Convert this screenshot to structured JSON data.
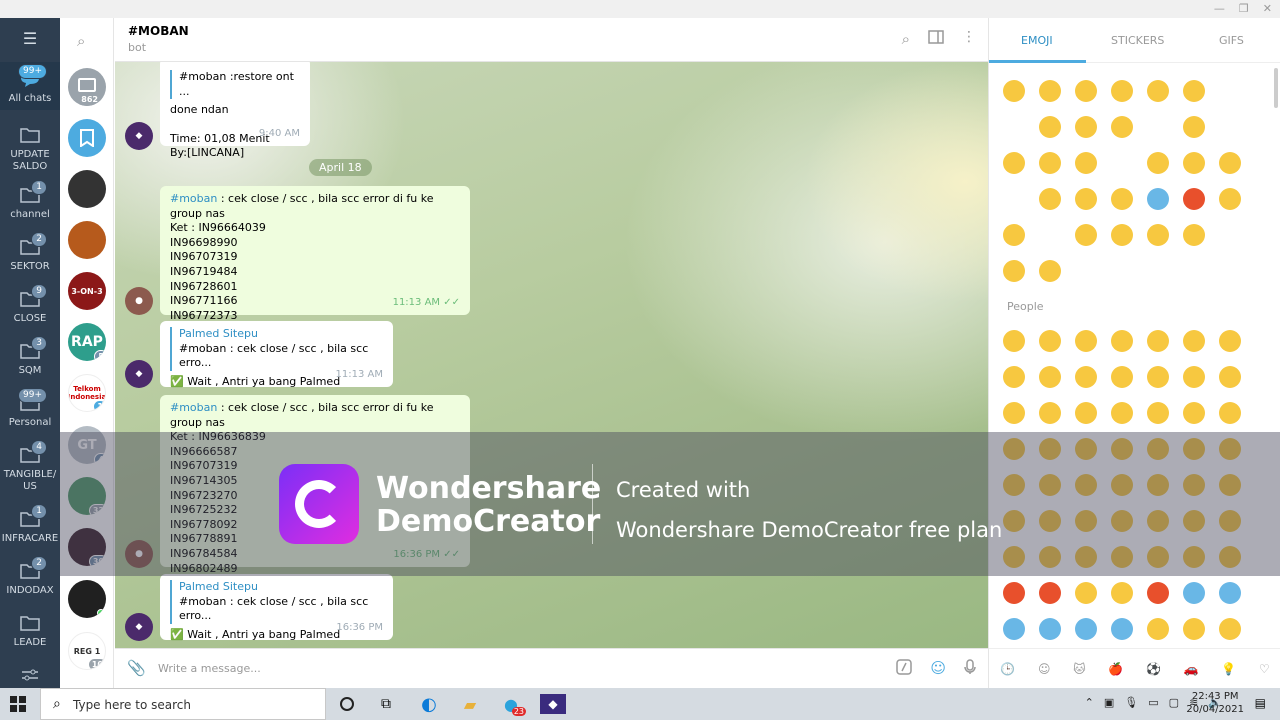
{
  "window": {
    "minimize": "—",
    "restore": "❐",
    "close": "✕"
  },
  "folders": [
    {
      "label": "All chats",
      "badge": "99+",
      "icon": "chat-bubble-icon"
    },
    {
      "label": "UPDATE SALDO",
      "badge": "",
      "icon": "folder-icon"
    },
    {
      "label": "channel",
      "badge": "1",
      "icon": "folder-icon"
    },
    {
      "label": "SEKTOR",
      "badge": "2",
      "icon": "folder-icon"
    },
    {
      "label": "CLOSE",
      "badge": "9",
      "icon": "folder-icon"
    },
    {
      "label": "SQM",
      "badge": "3",
      "icon": "folder-icon"
    },
    {
      "label": "Personal",
      "badge": "99+",
      "icon": "folder-icon"
    },
    {
      "label": "TANGIBLE/ US",
      "badge": "4",
      "icon": "folder-icon"
    },
    {
      "label": "INFRACARE",
      "badge": "1",
      "icon": "folder-icon"
    },
    {
      "label": "INDODAX",
      "badge": "2",
      "icon": "folder-icon"
    },
    {
      "label": "LEADE",
      "badge": "",
      "icon": "folder-icon"
    }
  ],
  "chats": [
    {
      "text": "",
      "badge": "862",
      "color": "#9aa3ab"
    },
    {
      "text": "",
      "badge": "",
      "color": "#4dabe0"
    },
    {
      "text": "",
      "badge": "",
      "color": "#333333"
    },
    {
      "text": "",
      "badge": "",
      "color": "#b65a1c"
    },
    {
      "text": "3-ON-3",
      "badge": "",
      "color": "#8c1818"
    },
    {
      "text": "RAP",
      "badge": "5",
      "color": "#2e9e8c"
    },
    {
      "text": "Telkom Indonesia",
      "badge": "1",
      "color": "#ffffff"
    },
    {
      "text": "GT",
      "badge": "4",
      "color": "#b4bcc4"
    },
    {
      "text": "",
      "badge": "33",
      "color": "#4f9a68"
    },
    {
      "text": "",
      "badge": "30",
      "color": "#3a1f2a"
    },
    {
      "text": "",
      "badge": "",
      "color": "#202020"
    },
    {
      "text": "REG 1",
      "badge": "10",
      "color": "#ffffff"
    }
  ],
  "header": {
    "title": "#MOBAN",
    "subtitle": "bot"
  },
  "messages": {
    "m1": {
      "reply": "#moban :restore ont ...",
      "lines": [
        "done ndan",
        "",
        "Time: 01,08 Menit",
        "By:[LINCANA]"
      ],
      "time": "9:40 AM"
    },
    "date": "April 18",
    "m2": {
      "tag": "#moban",
      "head": ": cek close / scc , bila scc error di fu ke group nas",
      "lines": [
        "Ket : IN96664039",
        "IN96698990",
        "IN96707319",
        "IN96719484",
        "IN96728601",
        "IN96771166",
        "IN96772373"
      ],
      "time": "11:13 AM",
      "check": "✓✓"
    },
    "m3": {
      "name": "Palmed Sitepu",
      "reply": "#moban : cek close / scc , bila scc erro...",
      "check": "✅",
      "body": "Wait , Antri ya bang Palmed",
      "time": "11:13 AM"
    },
    "m4": {
      "tag": "#moban",
      "head": ": cek close / scc , bila scc error di fu ke group nas",
      "lines": [
        "Ket :  IN96636839",
        "IN96666587",
        "IN96707319",
        "IN96714305",
        "IN96723270",
        "IN96725232",
        "IN96778092",
        "IN96778891",
        "IN96784584",
        "IN96802489"
      ],
      "time": "16:36 PM",
      "check": "✓✓"
    },
    "m5": {
      "name": "Palmed Sitepu",
      "reply": "#moban : cek close / scc , bila scc erro...",
      "check": "✅",
      "body": "Wait , Antri ya bang Palmed",
      "time": "16:36 PM"
    }
  },
  "composer": {
    "placeholder": "Write a message..."
  },
  "emoji": {
    "tabs": [
      "EMOJI",
      "STICKERS",
      "GIFS"
    ],
    "recent": [
      "😂",
      "😁",
      "😭",
      "🙄",
      "😍",
      "😞",
      "🤲",
      "👍",
      "😃",
      "😏",
      "😌",
      "⚠️",
      "😘",
      "❤️",
      "😊",
      "😒",
      "😄",
      "💋",
      "😒",
      "😳",
      "😜",
      "🙈",
      "😉",
      "😢",
      "😝",
      "😱",
      "😡",
      "😅",
      "😚",
      "🐵",
      "😌",
      "😀",
      "😋",
      "😆",
      "👌",
      "😐",
      "😕"
    ],
    "section": "People",
    "people": [
      "😀",
      "😃",
      "😄",
      "😁",
      "😆",
      "😅",
      "😂",
      "🤣",
      "☺️",
      "😊",
      "😇",
      "🙂",
      "🙃",
      "😉",
      "😌",
      "😍",
      "🥰",
      "😘",
      "😗",
      "😙",
      "😚",
      "😋",
      "😛",
      "😝",
      "😜",
      "🤪",
      "🤨",
      "🧐",
      "🤓",
      "😎",
      "🤩",
      "🥳",
      "😏",
      "😒",
      "😞",
      "😔",
      "😟",
      "😕",
      "🙁",
      "☹️",
      "😣",
      "😖",
      "😫",
      "😩",
      "🥺",
      "😢",
      "😭",
      "😤",
      "😠",
      "😡",
      "🤬",
      "🤯",
      "😳",
      "🥵",
      "🥶",
      "😱",
      "😨",
      "😰",
      "😥",
      "😓",
      "🤗",
      "🤔",
      "🤭"
    ],
    "bottom": [
      "🕒",
      "☺",
      "🐱",
      "🍎",
      "⚽",
      "🚗",
      "💡",
      "♡"
    ]
  },
  "watermark": {
    "brand1": "Wondershare",
    "brand2": "DemoCreator",
    "line1": "Created with",
    "line2": "Wondershare DemoCreator free plan"
  },
  "taskbar": {
    "search": "Type here to search",
    "time": "22:43 PM",
    "date": "20/04/2021",
    "tg_badge": "23"
  }
}
